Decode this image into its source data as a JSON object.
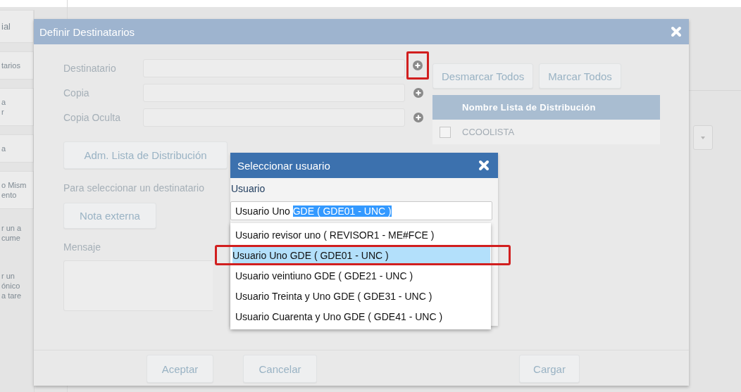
{
  "background": {
    "sidebar": [
      {
        "kind": "tab",
        "lines": [
          "ial"
        ]
      },
      {
        "kind": "tab",
        "lines": [
          "tarios"
        ]
      },
      {
        "kind": "tab",
        "lines": [
          "a",
          "r"
        ]
      },
      {
        "kind": "tab",
        "lines": [
          "a"
        ]
      },
      {
        "kind": "tab",
        "lines": [
          "o Mism",
          "ento"
        ]
      },
      {
        "kind": "text",
        "lines": [
          "r un a",
          "cume"
        ]
      },
      {
        "kind": "text",
        "lines": [
          "r un",
          "ónico",
          "a tare"
        ]
      }
    ]
  },
  "dialog": {
    "title": "Definir Destinatarios",
    "fields": [
      {
        "label": "Destinatario",
        "highlighted": true
      },
      {
        "label": "Copia",
        "highlighted": false
      },
      {
        "label": "Copia Oculta",
        "highlighted": false
      }
    ],
    "manage_button": "Adm. Lista de Distribución",
    "hint": "Para seleccionar un destinatario",
    "external_button": "Nota externa",
    "message_label": "Mensaje",
    "list_buttons": [
      "Desmarcar Todos",
      "Marcar Todos"
    ],
    "list_column": "Nombre Lista de Distribución",
    "list_rows": [
      {
        "name": "CCOOLISTA",
        "checked": false
      }
    ],
    "footer_buttons": [
      "Aceptar",
      "Cancelar",
      "Cargar"
    ]
  },
  "picker": {
    "title": "Seleccionar usuario",
    "label": "Usuario",
    "input": {
      "value": "Usuario Uno",
      "suggestion": "GDE ( GDE01 - UNC )"
    },
    "options": [
      {
        "label": "Usuario revisor uno ( REVISOR1 - ME#FCE )",
        "selected": false,
        "highlighted": false
      },
      {
        "label": "Usuario Uno GDE ( GDE01 - UNC )",
        "selected": true,
        "highlighted": true
      },
      {
        "label": "Usuario veintiuno GDE ( GDE21 - UNC )",
        "selected": false,
        "highlighted": false
      },
      {
        "label": "Usuario Treinta y Uno GDE ( GDE31 - UNC )",
        "selected": false,
        "highlighted": false
      },
      {
        "label": "Usuario Cuarenta y Uno GDE ( GDE41 - UNC )",
        "selected": false,
        "highlighted": false
      }
    ]
  }
}
